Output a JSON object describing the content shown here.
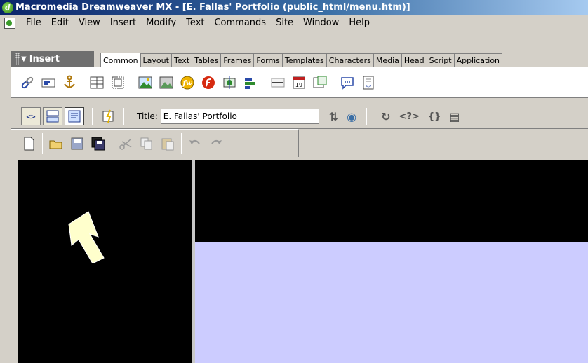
{
  "window": {
    "title": "Macromedia Dreamweaver MX - [E. Fallas' Portfolio (public_html/menu.htm)]"
  },
  "menu": [
    "File",
    "Edit",
    "View",
    "Insert",
    "Modify",
    "Text",
    "Commands",
    "Site",
    "Window",
    "Help"
  ],
  "insert_panel": {
    "title": "Insert",
    "tabs": [
      "Common",
      "Layout",
      "Text",
      "Tables",
      "Frames",
      "Forms",
      "Templates",
      "Characters",
      "Media",
      "Head",
      "Script",
      "Application"
    ],
    "active_tab": "Common"
  },
  "document_toolbar": {
    "title_label": "Title:",
    "title_value": "E. Fallas' Portfolio"
  },
  "colors": {
    "main_frame": "#ccccff",
    "frames": "#000000",
    "arrow": "#ffffcc"
  }
}
